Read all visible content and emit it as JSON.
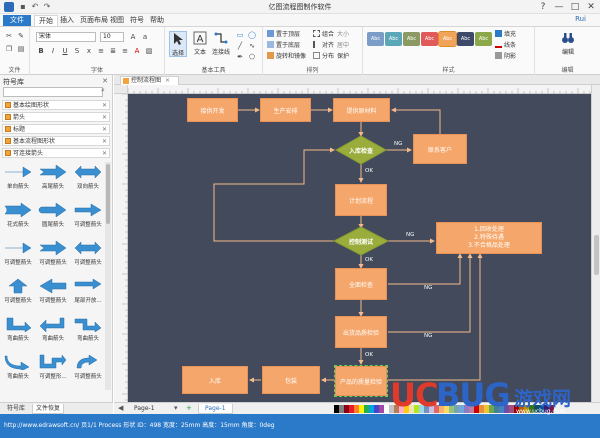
{
  "window": {
    "title": "亿图流程图制作软件",
    "controls": [
      "?",
      "—",
      "□",
      "✕"
    ]
  },
  "menu": {
    "tabs": [
      "文件",
      "开始",
      "插入",
      "页面布局",
      "视图",
      "符号",
      "帮助"
    ],
    "active": "开始",
    "user": "Rui"
  },
  "ribbon": {
    "font_name": "宋体",
    "font_size": "10",
    "groups": [
      "文件",
      "字体",
      "基本工具",
      "排列",
      "样式",
      "编辑"
    ],
    "tools": {
      "select": "选择",
      "text": "文本",
      "connector": "连接线"
    },
    "arrange": {
      "bring_front": "置于顶层",
      "send_back": "置于底层",
      "rotate": "旋转和镜像",
      "group": "组合",
      "align": "对齐",
      "size": "大小",
      "center": "居中",
      "distribute": "分布",
      "protect": "保护"
    },
    "style_swatches": [
      {
        "label": "Abc",
        "color": "#7a9cc6"
      },
      {
        "label": "Abc",
        "color": "#5aa7b8"
      },
      {
        "label": "Abc",
        "color": "#8a9a62"
      },
      {
        "label": "Abc",
        "color": "#e05a5a"
      },
      {
        "label": "Abc",
        "color": "#f0a45a"
      },
      {
        "label": "Abc",
        "color": "#3d4a6a"
      },
      {
        "label": "Abc",
        "color": "#8da84a"
      }
    ],
    "fill": "填充",
    "line": "线条",
    "shadow": "阴影",
    "edit": "编辑"
  },
  "library": {
    "title": "符号库",
    "categories": [
      "基本绘图形状",
      "箭头",
      "标题",
      "基本流程图形状",
      "可连接箭头"
    ],
    "shapes": [
      "单向箭头",
      "高尾箭头",
      "双向箭头",
      "花式箭头",
      "圆尾箭头",
      "可调整箭头",
      "可调整箭头",
      "可调整箭头",
      "可调整箭头",
      "可调整箭头",
      "可调整箭头",
      "尾部开放...",
      "弯曲箭头",
      "弯曲箭头",
      "弯曲箭头",
      "弯曲箭头",
      "可调整形...",
      "可调整箭头"
    ],
    "tabs": [
      "符号库",
      "文件恢复"
    ]
  },
  "document": {
    "tab": "控制流程图",
    "page_tab": "Page-1",
    "page_tab2": "Page-1"
  },
  "flow": {
    "nodes": {
      "dev": "接供开发",
      "produce": "生产安排",
      "material": "提供原材料",
      "inspect_in": "入库检查",
      "contact": "联系客户",
      "plan": "计划流程",
      "control_test": "控制测试",
      "full_check": "全面检查",
      "ship_check": "出货品质检验",
      "product_check": "产品的质量检验",
      "package": "包装",
      "warehouse": "入库"
    },
    "note_lines": [
      "1.回收处理",
      "2.特殊待遇",
      "3.不合格品处理"
    ],
    "edge_labels": {
      "ng1": "NG",
      "ok1": "OK",
      "ng2": "NG",
      "ok2": "OK",
      "ng3": "NG",
      "ng4": "NG",
      "ok3": "OK"
    }
  },
  "status": {
    "text": "http://www.edrawsoft.cn/   页1/1   Process  形状 ID：498  宽度：25mm  高度：15mm  角度：0deg"
  },
  "logo": {
    "uc": "UC",
    "bug": "BUG",
    "game": "游戏网",
    "url": "www.ucbug.com"
  },
  "palette": [
    "#000000",
    "#7f7f7f",
    "#880015",
    "#ed1c24",
    "#ff7f27",
    "#fff200",
    "#22b14c",
    "#00a2e8",
    "#3f48cc",
    "#a349a4",
    "#ffffff",
    "#c3c3c3",
    "#b97a57",
    "#ffaec9",
    "#ffc90e",
    "#efe4b0",
    "#b5e61d",
    "#99d9ea",
    "#7092be",
    "#c8bfe7",
    "#e06666",
    "#f6b26b",
    "#ffd966",
    "#93c47d",
    "#76a5af",
    "#6fa8dc",
    "#8e7cc3",
    "#c27ba0",
    "#cc0000",
    "#e69138",
    "#f1c232",
    "#6aa84f",
    "#45818e",
    "#3d85c6",
    "#674ea7",
    "#a64d79",
    "#990000",
    "#b45f06",
    "#bf9000",
    "#38761d",
    "#134f5c",
    "#0b5394",
    "#351c75",
    "#741b47"
  ]
}
